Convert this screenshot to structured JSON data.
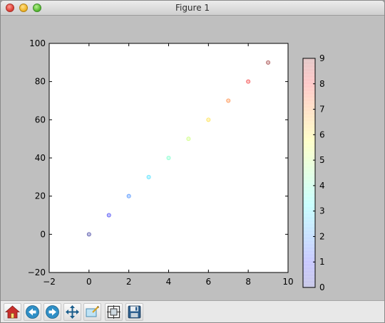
{
  "window": {
    "title": "Figure 1"
  },
  "toolbar": {
    "buttons": [
      {
        "icon": "home-icon"
      },
      {
        "icon": "back-arrow-icon"
      },
      {
        "icon": "forward-arrow-icon"
      },
      {
        "icon": "pan-move-icon"
      },
      {
        "icon": "zoom-rect-icon"
      },
      {
        "icon": "configure-subplots-icon"
      },
      {
        "icon": "save-floppy-icon"
      }
    ]
  },
  "chart_data": {
    "type": "scatter",
    "x": [
      0,
      1,
      2,
      3,
      4,
      5,
      6,
      7,
      8,
      9
    ],
    "y": [
      0,
      10,
      20,
      30,
      40,
      50,
      60,
      70,
      80,
      90
    ],
    "color_values": [
      0,
      1,
      2,
      3,
      4,
      5,
      6,
      7,
      8,
      9
    ],
    "xlim": [
      -2,
      10
    ],
    "ylim": [
      -20,
      100
    ],
    "xticks": [
      "−2",
      "0",
      "2",
      "4",
      "6",
      "8",
      "10"
    ],
    "yticks": [
      "−20",
      "0",
      "20",
      "40",
      "60",
      "80",
      "100"
    ],
    "colorbar": {
      "range": [
        0,
        9
      ],
      "ticks": [
        "0",
        "1",
        "2",
        "3",
        "4",
        "5",
        "6",
        "7",
        "8",
        "9"
      ],
      "colormap": "jet",
      "alpha": 0.25
    },
    "grid": false,
    "background": "#ffffff"
  }
}
